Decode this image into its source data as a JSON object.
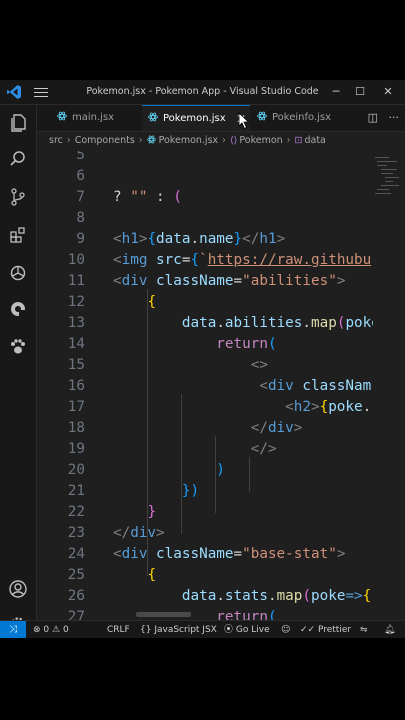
{
  "window": {
    "title": "Pokemon.jsx - Pokemon App - Visual Studio Code"
  },
  "tabs": [
    {
      "label": "main.jsx"
    },
    {
      "label": "Pokemon.jsx",
      "active": true
    },
    {
      "label": "Pokeinfo.jsx"
    }
  ],
  "breadcrumb": [
    "src",
    "Components",
    "Pokemon.jsx",
    "Pokemon",
    "data"
  ],
  "activity_icons": [
    "explorer-icon",
    "search-icon",
    "source-control-icon",
    "extensions-icon",
    "openai-icon",
    "quokka-icon",
    "paw-icon",
    "account-icon",
    "settings-gear-icon"
  ],
  "editor": {
    "line_numbers": [
      "5",
      "6",
      "7",
      "8",
      "9",
      "10",
      "11",
      "12",
      "13",
      "14",
      "15",
      "16",
      "17",
      "18",
      "19",
      "20",
      "21",
      "22",
      "23",
      "24",
      "25",
      "26",
      "27"
    ]
  },
  "status": {
    "errors": "0",
    "warnings": "0",
    "eol": "CRLF",
    "language": "JavaScript JSX",
    "go_live": "Go Live",
    "prettier": "Prettier"
  },
  "colors": {
    "accent": "#0078d4",
    "background": "#1f1f1f"
  }
}
